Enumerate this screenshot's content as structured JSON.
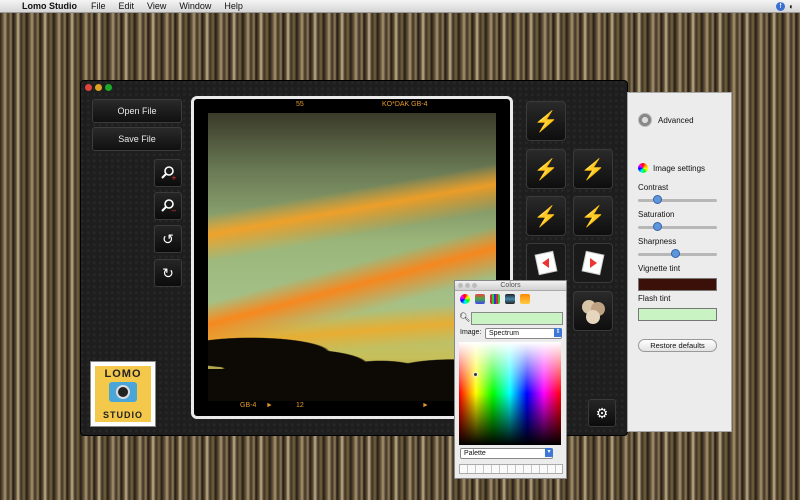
{
  "menubar": {
    "app_name": "Lomo Studio",
    "items": [
      "File",
      "Edit",
      "View",
      "Window",
      "Help"
    ]
  },
  "left_panel": {
    "open_label": "Open File",
    "save_label": "Save File",
    "logo_top": "LOMO",
    "logo_bottom": "STUDIO"
  },
  "frame": {
    "top_left_number": "55",
    "top_right_text": "KO*DAK GB-4",
    "bottom_left_text": "GB-4",
    "bottom_arrow": "►",
    "bottom_number": "12",
    "bottom_right_arrow": "►"
  },
  "flash_buttons": {
    "white": "#ffffff",
    "red": "#ff2020",
    "yellow": "#ffee00",
    "blue": "#1a3aff",
    "green": "#30ff30"
  },
  "advanced_panel": {
    "title": "Advanced",
    "image_settings": "Image settings",
    "contrast_label": "Contrast",
    "contrast_value": 0.2,
    "saturation_label": "Saturation",
    "saturation_value": 0.2,
    "sharpness_label": "Sharpness",
    "sharpness_value": 0.45,
    "vignette_label": "Vignette tint",
    "vignette_color": "#3a1008",
    "flash_label": "Flash tint",
    "flash_color": "#c9f3c3",
    "restore_label": "Restore defaults"
  },
  "colors_panel": {
    "title": "Colors",
    "image_label": "Image:",
    "image_select": "Spectrum",
    "palette_select": "Palette",
    "current_color": "#c9f3c3"
  }
}
